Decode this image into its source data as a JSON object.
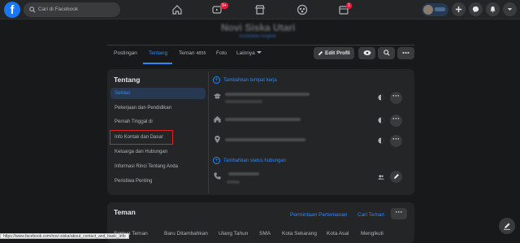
{
  "topbar": {
    "search_placeholder": "Cari di Facebook",
    "logo": "f",
    "watch_badge": "9+",
    "gaming_badge": "1"
  },
  "profile": {
    "name": "Novi Siska Utari",
    "subname": "Sistaskiie Angkat"
  },
  "tabs": [
    {
      "label": "Postingan"
    },
    {
      "label": "Tentang"
    },
    {
      "label": "Teman"
    },
    {
      "label": "Foto"
    },
    {
      "label": "Lainnya"
    }
  ],
  "friend_count": "4855",
  "edit_profile_label": "Edit Profil",
  "about": {
    "title": "Tentang",
    "menu": [
      "Sekilas",
      "Pekerjaan dan Pendidikan",
      "Pernah Tinggal di",
      "Info Kontak dan Dasar",
      "Keluarga dan Hubungan",
      "Informasi Rinci Tentang Anda",
      "Peristiwa Penting"
    ],
    "add_workplace": "Tambahkan tempat kerja",
    "add_relationship": "Tambahkan status hubungan"
  },
  "friends": {
    "title": "Teman",
    "requests_link": "Permintaan Pertemanan",
    "find_link": "Cari Teman",
    "tabs": [
      "Semua Teman",
      "Baru Ditambahkan",
      "Ulang Tahun",
      "SMA",
      "Kota Sekarang",
      "Kota Asal",
      "Mengikuti"
    ]
  },
  "status_url": "https://www.facebook.com/novi.siska/about_contact_and_basic_info",
  "colors": {
    "accent": "#2d88ff",
    "bg": "#18191a",
    "card": "#242526",
    "highlight_box": "#e02020"
  }
}
